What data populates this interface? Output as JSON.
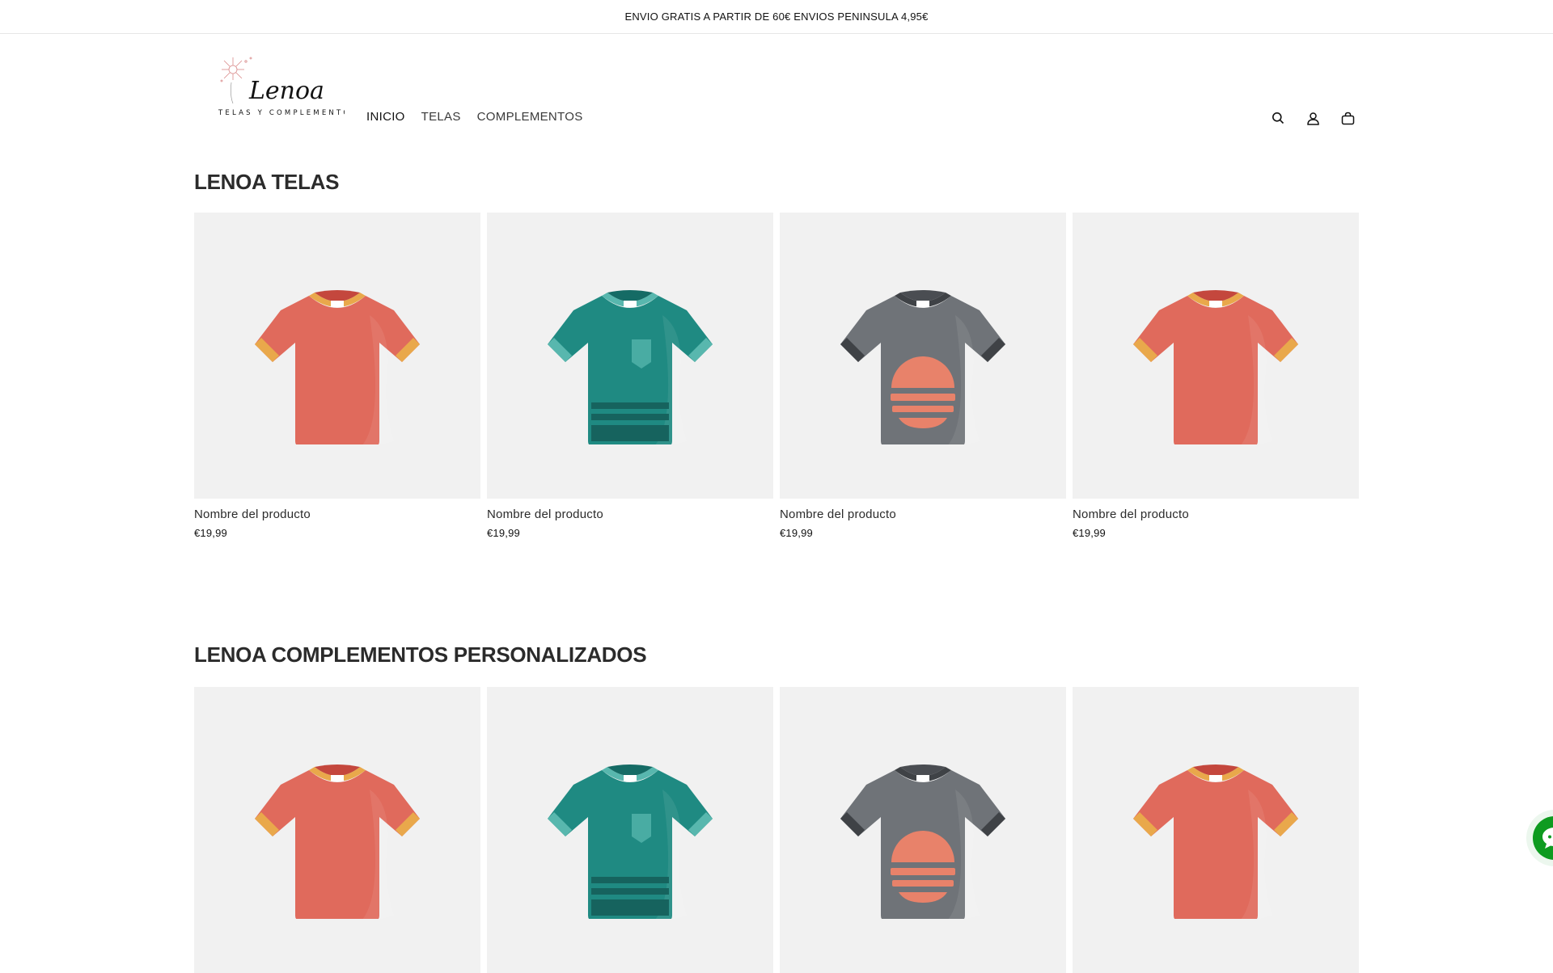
{
  "announcement": {
    "text": "ENVIO GRATIS A PARTIR DE 60€ ENVIOS PENINSULA 4,95€"
  },
  "header": {
    "logo": {
      "name": "Lenoa",
      "tagline": "TELAS Y COMPLEMENTOS"
    },
    "nav": [
      {
        "label": "INICIO"
      },
      {
        "label": "TELAS"
      },
      {
        "label": "COMPLEMENTOS"
      }
    ],
    "icons": [
      "search-icon",
      "account-icon",
      "cart-icon"
    ]
  },
  "sections": [
    {
      "title": "LENOA TELAS",
      "products": [
        {
          "name": "Nombre del producto",
          "price": "€19,99",
          "variant": "coral"
        },
        {
          "name": "Nombre del producto",
          "price": "€19,99",
          "variant": "teal"
        },
        {
          "name": "Nombre del producto",
          "price": "€19,99",
          "variant": "gray"
        },
        {
          "name": "Nombre del producto",
          "price": "€19,99",
          "variant": "coral"
        }
      ]
    },
    {
      "title": "LENOA COMPLEMENTOS PERSONALIZADOS",
      "products": [
        {
          "variant": "coral"
        },
        {
          "variant": "teal"
        },
        {
          "variant": "gray"
        },
        {
          "variant": "coral"
        }
      ]
    }
  ],
  "colors": {
    "coral_body": "#e06a5c",
    "coral_trim": "#e9a84b",
    "teal_body": "#1f8a82",
    "teal_trim": "#58b7ae",
    "gray_body": "#6f7378",
    "gray_trim": "#3f4246",
    "sunset": "#e8826a",
    "chat": "#0e9b20"
  },
  "chat_widget": {
    "icon": "chat-bubble-icon"
  }
}
